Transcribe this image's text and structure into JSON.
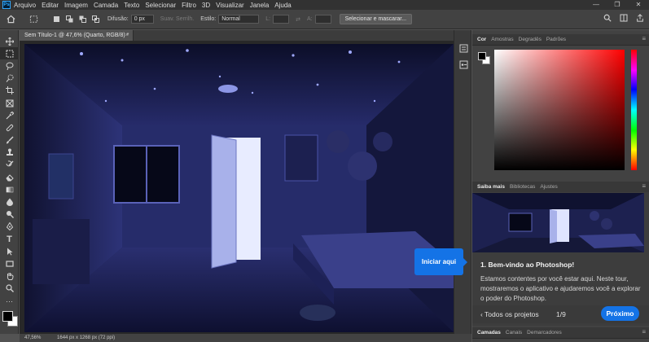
{
  "menu": {
    "logo": "Ps",
    "items": [
      "Arquivo",
      "Editar",
      "Imagem",
      "Camada",
      "Texto",
      "Selecionar",
      "Filtro",
      "3D",
      "Visualizar",
      "Janela",
      "Ajuda"
    ],
    "window_buttons": [
      "—",
      "❐",
      "✕"
    ]
  },
  "options_bar": {
    "feather_label": "Difusão:",
    "feather_value": "0 px",
    "antialias_label": "Suav. Serrilh.",
    "style_label": "Estilo:",
    "style_value": "Normal",
    "width_label": "L:",
    "height_label": "A:",
    "select_mask_button": "Selecionar e mascarar..."
  },
  "document": {
    "tab_title": "Sem Título-1 @ 47,6% (Quarto, RGB/8) *",
    "close": "×"
  },
  "status_bar": {
    "zoom": "47,56%",
    "dimensions": "1644 px x 1268 px (72 ppi)"
  },
  "color_panel": {
    "tabs": [
      "Cor",
      "Amostras",
      "Degradês",
      "Padrões"
    ],
    "active_tab": "Cor",
    "foreground_color": "#000000",
    "background_color": "#ffffff"
  },
  "learn_panel": {
    "tabs": [
      "Saiba mais",
      "Bibliotecas",
      "Ajustes"
    ],
    "active_tab": "Saiba mais",
    "title": "1.  Bem-vindo ao Photoshop!",
    "body": "Estamos contentes por você estar aqui. Neste tour, mostraremos o aplicativo e ajudaremos você a explorar o poder do Photoshop.",
    "prev_link": "‹  Todos os projetos",
    "page": "1/9",
    "next_button": "Próximo"
  },
  "layers_panel": {
    "tabs": [
      "Camadas",
      "Canais",
      "Demarcadores"
    ],
    "active_tab": "Camadas"
  },
  "callout": {
    "label": "Iniciar aqui"
  },
  "accent_color": "#1473e6"
}
